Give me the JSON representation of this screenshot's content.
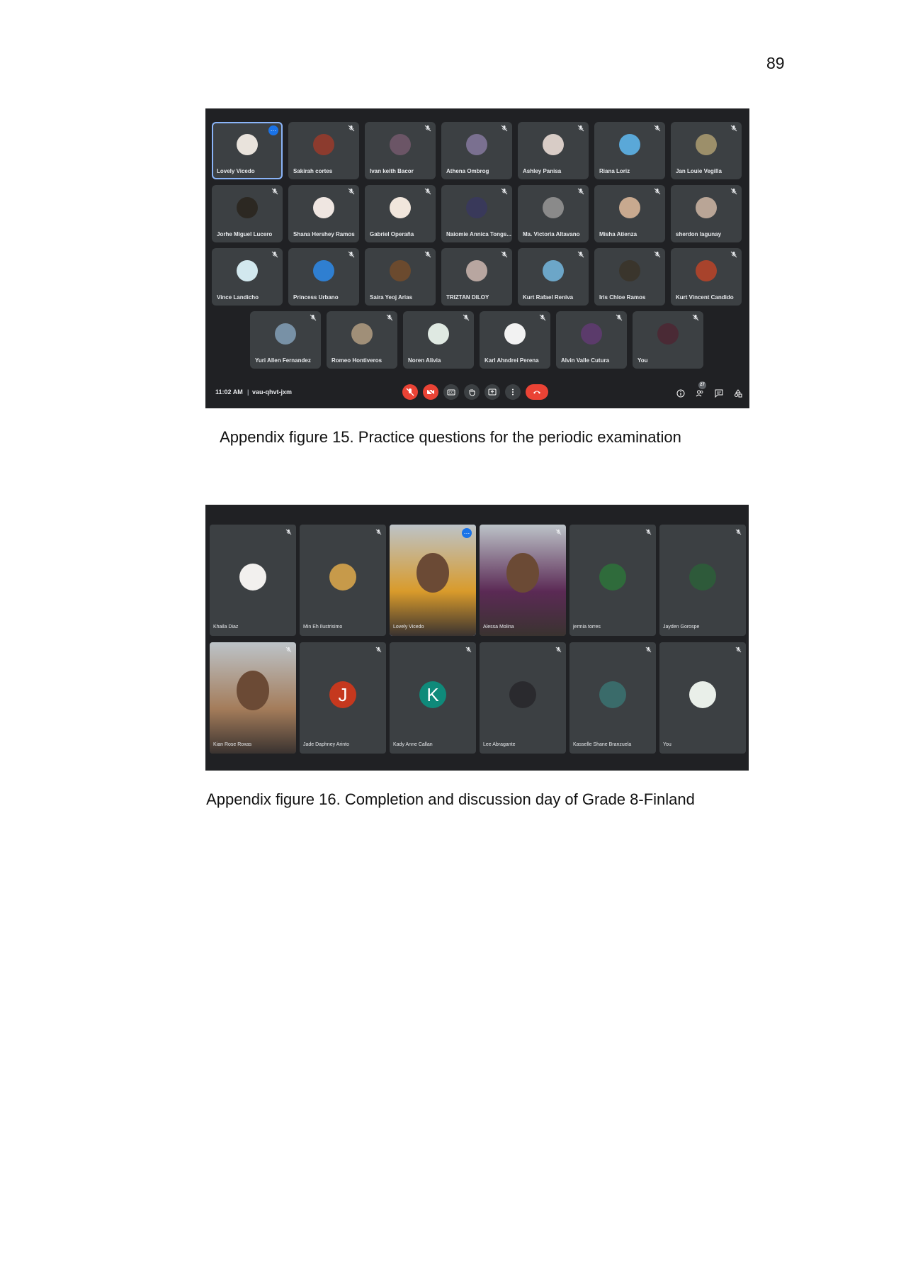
{
  "page": {
    "number": "89"
  },
  "figure1": {
    "caption": "Appendix figure 15. Practice questions for the periodic examination",
    "participants": [
      {
        "name": "Lovely Vicedo",
        "avatar_color": "#e9e3dc"
      },
      {
        "name": "Sakirah cortes",
        "avatar_color": "#8c3b2e"
      },
      {
        "name": "Ivan keith Bacor",
        "avatar_color": "#6b5566"
      },
      {
        "name": "Athena Ombrog",
        "avatar_color": "#7a7090"
      },
      {
        "name": "Ashley Panisa",
        "avatar_color": "#d8ccc6"
      },
      {
        "name": "Riana Loriz",
        "avatar_color": "#5aa8d8"
      },
      {
        "name": "Jan Louie Vegilla",
        "avatar_color": "#9c8f6a"
      },
      {
        "name": "Jorhe Miguel Lucero",
        "avatar_color": "#2c2822"
      },
      {
        "name": "Shana Hershey Ramos",
        "avatar_color": "#efe6e1"
      },
      {
        "name": "Gabriel Operaña",
        "avatar_color": "#f1e6dc"
      },
      {
        "name": "Naiomie Annica Tongs...",
        "avatar_color": "#39395a"
      },
      {
        "name": "Ma. Victoria Altavano",
        "avatar_color": "#8a8a8a"
      },
      {
        "name": "Misha Atienza",
        "avatar_color": "#c8a98f"
      },
      {
        "name": "sherdon lagunay",
        "avatar_color": "#b9a596"
      },
      {
        "name": "Vince Landicho",
        "avatar_color": "#d2e8ee"
      },
      {
        "name": "Princess Urbano",
        "avatar_color": "#2f7fd1"
      },
      {
        "name": "Saira Yeoj Arias",
        "avatar_color": "#6b4a2e"
      },
      {
        "name": "TRIZTAN DILOY",
        "avatar_color": "#b8a6a0"
      },
      {
        "name": "Kurt Rafael Reniva",
        "avatar_color": "#6ca6c8"
      },
      {
        "name": "Iris Chloe Ramos",
        "avatar_color": "#3a352c"
      },
      {
        "name": "Kurt Vincent Candido",
        "avatar_color": "#a8432c"
      },
      {
        "name": "Yuri Allen Fernandez",
        "avatar_color": "#7891a6"
      },
      {
        "name": "Romeo Hontiveros",
        "avatar_color": "#a08f78"
      },
      {
        "name": "Noren Alivia",
        "avatar_color": "#dfe9e2"
      },
      {
        "name": "Karl Ahndrei Perena",
        "avatar_color": "#f2f2f2"
      },
      {
        "name": "Alvin Valle Cutura",
        "avatar_color": "#5b3b6b"
      },
      {
        "name": "You",
        "avatar_color": "#4a2a35"
      }
    ],
    "bottom_bar": {
      "time": "11:02 AM",
      "separator": "|",
      "meeting_code": "vau-qhvt-jxm",
      "people_count": "27",
      "controls": [
        "mic-off-icon",
        "camera-off-icon",
        "captions-icon",
        "raise-hand-icon",
        "present-icon",
        "more-options-icon",
        "end-call-icon"
      ],
      "right_controls": [
        "info-icon",
        "people-icon",
        "chat-icon",
        "activities-icon"
      ]
    }
  },
  "figure2": {
    "caption": "Appendix figure 16. Completion and discussion day of Grade 8-Finland",
    "participants": [
      {
        "name": "Khaila Diaz",
        "type": "avatar",
        "avatar_color": "#f2f0ee"
      },
      {
        "name": "Min Eh Ilustrisimo",
        "type": "avatar",
        "avatar_color": "#c79a4a"
      },
      {
        "name": "Lovely Vicedo",
        "type": "video",
        "avatar_color": "#d99b2b"
      },
      {
        "name": "Alessa Molina",
        "type": "video",
        "avatar_color": "#5b2a55"
      },
      {
        "name": "jermia torres",
        "type": "avatar",
        "avatar_color": "#2f6b3b"
      },
      {
        "name": "Jayden Gorospe",
        "type": "avatar",
        "avatar_color": "#2e5a3a"
      },
      {
        "name": "Kian Rose Roxas",
        "type": "video",
        "avatar_color": "#a47c5a"
      },
      {
        "name": "Jade Daphney Arinto",
        "type": "letter",
        "letter": "J",
        "avatar_color": "#c5381e"
      },
      {
        "name": "Kady Anne Callan",
        "type": "letter",
        "letter": "K",
        "avatar_color": "#0f8a7a"
      },
      {
        "name": "Lee Abragante",
        "type": "avatar",
        "avatar_color": "#2a2a2e"
      },
      {
        "name": "Kasselle Shane Branzuela",
        "type": "avatar",
        "avatar_color": "#3a6b6a"
      },
      {
        "name": "You",
        "type": "avatar",
        "avatar_color": "#e9efe9"
      }
    ]
  }
}
